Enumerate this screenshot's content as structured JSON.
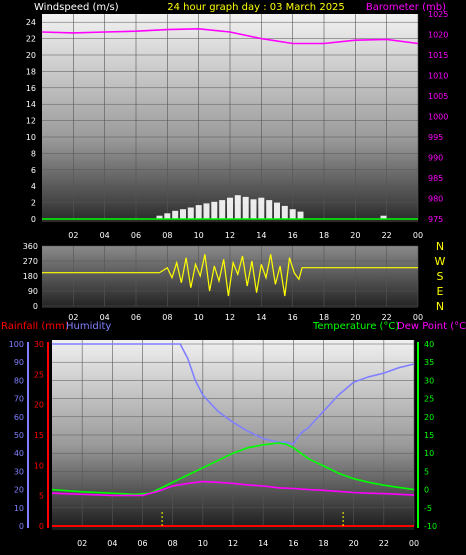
{
  "header": {
    "left_label": "Windspeed (m/s)",
    "title": "24 hour graph day : 03 March 2025",
    "right_label": "Barometer (mb)"
  },
  "colors": {
    "windspeed": "#ffffff",
    "gust_base": "#00ff00",
    "barometer": "#ff00ff",
    "wind_dir": "#ffff00",
    "rainfall": "#ff0000",
    "humidity": "#8080ff",
    "temperature": "#00ff00",
    "dew_point": "#ff00ff",
    "title": "#ffff00",
    "tick": "#ffffff",
    "grid": "#555555"
  },
  "chart_data": [
    {
      "id": "wind-baro",
      "type": "line",
      "xlabel": "",
      "x_ticks": [
        "02",
        "04",
        "06",
        "08",
        "10",
        "12",
        "14",
        "16",
        "18",
        "20",
        "22",
        "00"
      ],
      "left_axis": {
        "label": "Windspeed (m/s)",
        "ylim": [
          0,
          25
        ],
        "ticks": [
          0,
          2,
          4,
          6,
          8,
          10,
          12,
          14,
          16,
          18,
          20,
          22,
          24
        ]
      },
      "right_axis": {
        "label": "Barometer (mb)",
        "ylim": [
          975,
          1025
        ],
        "ticks": [
          975,
          980,
          985,
          990,
          995,
          1000,
          1005,
          1010,
          1015,
          1020,
          1025
        ]
      },
      "series": [
        {
          "name": "Barometer (mb)",
          "axis": "right",
          "x": [
            0,
            2,
            4,
            6,
            8,
            10,
            12,
            14,
            16,
            18,
            20,
            22,
            24
          ],
          "y": [
            1020.6,
            1020.4,
            1020.6,
            1020.8,
            1021.2,
            1021.4,
            1020.6,
            1019.0,
            1017.8,
            1017.8,
            1018.6,
            1018.8,
            1017.8
          ]
        },
        {
          "name": "Windspeed (m/s)",
          "axis": "left",
          "style": "bars",
          "x": [
            7.5,
            8.0,
            8.5,
            9.0,
            9.5,
            10.0,
            10.5,
            11.0,
            11.5,
            12.0,
            12.5,
            13.0,
            13.5,
            14.0,
            14.5,
            15.0,
            15.5,
            16.0,
            16.5,
            21.8
          ],
          "y": [
            0.4,
            0.7,
            1.0,
            1.2,
            1.4,
            1.7,
            1.9,
            2.1,
            2.3,
            2.6,
            2.9,
            2.7,
            2.4,
            2.6,
            2.3,
            2.0,
            1.6,
            1.2,
            0.9,
            0.4
          ]
        }
      ]
    },
    {
      "id": "wind-direction",
      "type": "line",
      "x_ticks": [
        "02",
        "04",
        "06",
        "08",
        "10",
        "12",
        "14",
        "16",
        "18",
        "20",
        "22",
        "00"
      ],
      "left_axis": {
        "label": "",
        "ylim": [
          0,
          360
        ],
        "ticks": [
          0,
          90,
          180,
          270,
          360
        ]
      },
      "compass": [
        "N",
        "W",
        "S",
        "E",
        "N"
      ],
      "series": [
        {
          "name": "",
          "x": [
            0,
            7.5,
            8.0,
            8.3,
            8.6,
            8.9,
            9.2,
            9.5,
            9.8,
            10.1,
            10.4,
            10.7,
            11.0,
            11.3,
            11.6,
            11.9,
            12.2,
            12.5,
            12.8,
            13.1,
            13.4,
            13.7,
            14.0,
            14.3,
            14.6,
            14.9,
            15.2,
            15.5,
            15.8,
            16.1,
            16.4,
            16.6,
            17.0,
            24
          ],
          "y": [
            200,
            200,
            230,
            170,
            260,
            140,
            290,
            110,
            250,
            180,
            310,
            90,
            240,
            150,
            280,
            60,
            260,
            190,
            300,
            120,
            270,
            80,
            250,
            170,
            310,
            130,
            240,
            60,
            290,
            200,
            160,
            230,
            230,
            230
          ]
        }
      ]
    },
    {
      "id": "rain-humidity-temp",
      "type": "line",
      "x_ticks": [
        "02",
        "04",
        "06",
        "08",
        "10",
        "12",
        "14",
        "16",
        "18",
        "20",
        "22",
        "00"
      ],
      "left_axes": [
        {
          "label": "Humidity",
          "ylim": [
            0,
            100
          ],
          "ticks": [
            0,
            10,
            20,
            30,
            40,
            50,
            60,
            70,
            80,
            90,
            100
          ]
        },
        {
          "label": "Rainfall (mm)",
          "ylim": [
            0,
            30
          ],
          "ticks": [
            0,
            5,
            10,
            15,
            20,
            25,
            30
          ]
        }
      ],
      "right_axis": {
        "label": "Temperature (°C) Dew Point (°C)",
        "ylim": [
          -10,
          40
        ],
        "ticks": [
          -10,
          -5,
          0,
          5,
          10,
          15,
          20,
          25,
          30,
          35,
          40
        ]
      },
      "series": [
        {
          "name": "Humidity",
          "axis": "humidity",
          "x": [
            0,
            2,
            4,
            6,
            8.5,
            9.0,
            9.5,
            10.0,
            11.0,
            12.0,
            13.0,
            14.0,
            15.0,
            15.5,
            16.0,
            16.5,
            17.0,
            18.0,
            19.0,
            20.0,
            21.0,
            22.0,
            23.0,
            24.0
          ],
          "y": [
            100,
            100,
            100,
            100,
            100,
            92,
            80,
            72,
            63,
            57,
            52,
            48,
            46,
            46,
            45,
            51,
            54,
            63,
            72,
            79,
            82,
            84,
            87,
            89
          ]
        },
        {
          "name": "Temperature (°C)",
          "axis": "right",
          "x": [
            0,
            2,
            4,
            5.5,
            6.5,
            7.0,
            7.5,
            8.0,
            9.0,
            10.0,
            11.0,
            12.0,
            13.0,
            14.0,
            15.0,
            15.5,
            16.0,
            17.0,
            18.0,
            19.0,
            20.0,
            21.0,
            22.0,
            23.0,
            24.0
          ],
          "y": [
            0.0,
            -0.6,
            -1.0,
            -1.3,
            -1.0,
            0.0,
            1.0,
            2.0,
            4.0,
            6.0,
            8.0,
            10.0,
            11.5,
            12.3,
            12.8,
            12.5,
            11.5,
            8.5,
            6.5,
            4.5,
            3.0,
            2.0,
            1.2,
            0.6,
            0.0
          ]
        },
        {
          "name": "Dew Point (°C)",
          "axis": "right",
          "x": [
            0,
            2,
            4,
            6,
            7.0,
            8.0,
            9.0,
            10.0,
            11.0,
            12.0,
            13.0,
            14.0,
            15.0,
            16.0,
            17.0,
            18.0,
            19.0,
            20.0,
            21.0,
            22.0,
            23.0,
            24.0
          ],
          "y": [
            -1.0,
            -1.3,
            -1.6,
            -1.6,
            -0.5,
            1.0,
            1.7,
            2.2,
            2.0,
            1.7,
            1.3,
            1.0,
            0.5,
            0.3,
            0.0,
            -0.2,
            -0.5,
            -0.8,
            -1.0,
            -1.1,
            -1.3,
            -1.5
          ]
        },
        {
          "name": "Rainfall (mm)",
          "axis": "rain",
          "x": [
            0,
            24
          ],
          "y": [
            0,
            0
          ]
        }
      ],
      "markers": {
        "sunrise": 7.3,
        "sunset": 19.3
      }
    }
  ]
}
